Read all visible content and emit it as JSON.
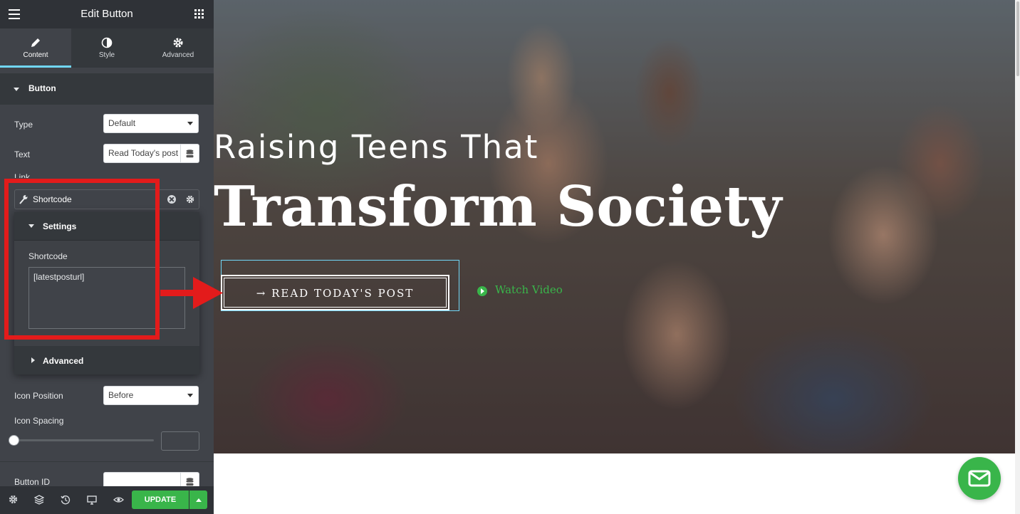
{
  "panel": {
    "title": "Edit Button",
    "tabs": [
      {
        "label": "Content",
        "icon": "pencil-icon"
      },
      {
        "label": "Style",
        "icon": "contrast-icon"
      },
      {
        "label": "Advanced",
        "icon": "gear-icon"
      }
    ],
    "section_title": "Button",
    "type_label": "Type",
    "type_value": "Default",
    "text_label": "Text",
    "text_value": "Read Today's post",
    "link_label": "Link",
    "dynamic_tag": "Shortcode",
    "popover": {
      "settings_title": "Settings",
      "shortcode_label": "Shortcode",
      "shortcode_value": "[latestposturl]",
      "advanced_title": "Advanced"
    },
    "icon_position_label": "Icon Position",
    "icon_position_value": "Before",
    "icon_spacing_label": "Icon Spacing",
    "icon_spacing_value": 0,
    "button_id_label": "Button ID",
    "update_label": "UPDATE"
  },
  "preview": {
    "headline_1": "Raising Teens That",
    "headline_2": "Transform Society",
    "cta_label": "READ TODAY'S POST",
    "watch_label": "Watch Video"
  },
  "colors": {
    "panel_bg": "#404349",
    "accent_tab": "#71d7f7",
    "update_green": "#39b54a",
    "annotation_red": "#e31b1b"
  }
}
